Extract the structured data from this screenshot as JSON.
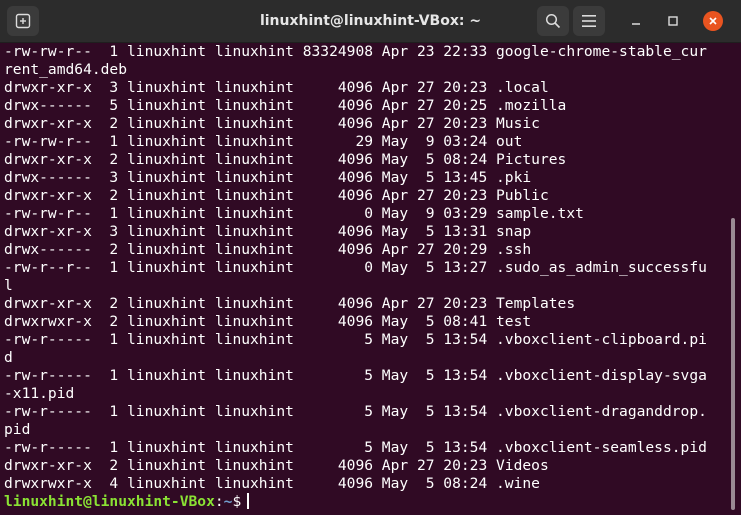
{
  "window": {
    "title": "linuxhint@linuxhint-VBox: ~"
  },
  "icons": {
    "new_tab": "new-tab-icon",
    "search": "search-icon",
    "menu": "hamburger-menu-icon",
    "minimize": "minimize-icon",
    "maximize": "maximize-icon",
    "close": "close-icon"
  },
  "colors": {
    "terminal_bg": "#300a24",
    "titlebar_bg": "#2c2c2c",
    "prompt_user": "#8ae234",
    "prompt_path": "#729fcf",
    "close_button": "#e95420"
  },
  "terminal": {
    "lines": [
      "-rw-rw-r--  1 linuxhint linuxhint 83324908 Apr 23 22:33 google-chrome-stable_cur",
      "rent_amd64.deb",
      "drwxr-xr-x  3 linuxhint linuxhint     4096 Apr 27 20:23 .local",
      "drwx------  5 linuxhint linuxhint     4096 Apr 27 20:25 .mozilla",
      "drwxr-xr-x  2 linuxhint linuxhint     4096 Apr 27 20:23 Music",
      "-rw-rw-r--  1 linuxhint linuxhint       29 May  9 03:24 out",
      "drwxr-xr-x  2 linuxhint linuxhint     4096 May  5 08:24 Pictures",
      "drwx------  3 linuxhint linuxhint     4096 May  5 13:45 .pki",
      "drwxr-xr-x  2 linuxhint linuxhint     4096 Apr 27 20:23 Public",
      "-rw-rw-r--  1 linuxhint linuxhint        0 May  9 03:29 sample.txt",
      "drwxr-xr-x  3 linuxhint linuxhint     4096 May  5 13:31 snap",
      "drwx------  2 linuxhint linuxhint     4096 Apr 27 20:29 .ssh",
      "-rw-r--r--  1 linuxhint linuxhint        0 May  5 13:27 .sudo_as_admin_successfu",
      "l",
      "drwxr-xr-x  2 linuxhint linuxhint     4096 Apr 27 20:23 Templates",
      "drwxrwxr-x  2 linuxhint linuxhint     4096 May  5 08:41 test",
      "-rw-r-----  1 linuxhint linuxhint        5 May  5 13:54 .vboxclient-clipboard.pi",
      "d",
      "-rw-r-----  1 linuxhint linuxhint        5 May  5 13:54 .vboxclient-display-svga",
      "-x11.pid",
      "-rw-r-----  1 linuxhint linuxhint        5 May  5 13:54 .vboxclient-draganddrop.",
      "pid",
      "-rw-r-----  1 linuxhint linuxhint        5 May  5 13:54 .vboxclient-seamless.pid",
      "drwxr-xr-x  2 linuxhint linuxhint     4096 Apr 27 20:23 Videos",
      "drwxrwxr-x  4 linuxhint linuxhint     4096 May  5 08:24 .wine"
    ],
    "prompt": {
      "user_host": "linuxhint@linuxhint-VBox",
      "separator": ":",
      "path": "~",
      "symbol": "$"
    }
  }
}
